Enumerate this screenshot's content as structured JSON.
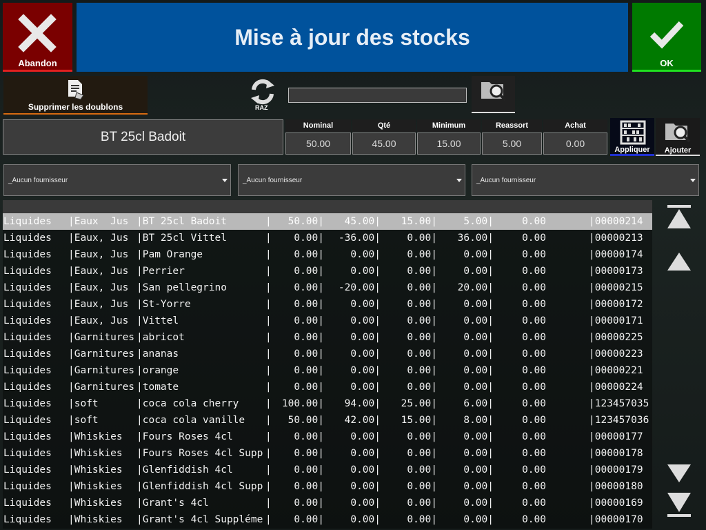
{
  "header": {
    "title": "Mise à jour des stocks",
    "abandon_label": "Abandon",
    "ok_label": "OK",
    "abandon_color": "#7a0000",
    "title_color": "#00529c",
    "ok_color": "#007a00"
  },
  "toolbar": {
    "dedup_label": "Supprimer les doublons",
    "raz_label": "RAZ",
    "search_value": ""
  },
  "product": {
    "name": "BT 25cl Badoit",
    "columns": [
      {
        "label": "Nominal",
        "value": "50.00"
      },
      {
        "label": "Qté",
        "value": "45.00"
      },
      {
        "label": "Minimum",
        "value": "15.00"
      },
      {
        "label": "Reassort",
        "value": "5.00"
      },
      {
        "label": "Achat",
        "value": "0.00"
      }
    ],
    "appliquer_label": "Appliquer",
    "ajouter_label": "Ajouter"
  },
  "suppliers": [
    "_Aucun fournisseur",
    "_Aucun fournisseur",
    "_Aucun fournisseur"
  ],
  "table": {
    "selected_index": 0,
    "rows": [
      [
        "Liquides",
        "|Eaux  Jus",
        "|BT 25cl Badoit",
        "|",
        "50.00|",
        "45.00|",
        "15.00|",
        "5.00|",
        "0.00",
        "|00000214"
      ],
      [
        "Liquides",
        "|Eaux, Jus",
        "|BT 25cl Vittel",
        "|",
        "0.00|",
        "-36.00|",
        "0.00|",
        "36.00|",
        "0.00",
        "|00000213"
      ],
      [
        "Liquides",
        "|Eaux, Jus",
        "|Pam Orange",
        "|",
        "0.00|",
        "0.00|",
        "0.00|",
        "0.00|",
        "0.00",
        "|00000174"
      ],
      [
        "Liquides",
        "|Eaux, Jus",
        "|Perrier",
        "|",
        "0.00|",
        "0.00|",
        "0.00|",
        "0.00|",
        "0.00",
        "|00000173"
      ],
      [
        "Liquides",
        "|Eaux, Jus",
        "|San pellegrino",
        "|",
        "0.00|",
        "-20.00|",
        "0.00|",
        "20.00|",
        "0.00",
        "|00000215"
      ],
      [
        "Liquides",
        "|Eaux, Jus",
        "|St-Yorre",
        "|",
        "0.00|",
        "0.00|",
        "0.00|",
        "0.00|",
        "0.00",
        "|00000172"
      ],
      [
        "Liquides",
        "|Eaux, Jus",
        "|Vittel",
        "|",
        "0.00|",
        "0.00|",
        "0.00|",
        "0.00|",
        "0.00",
        "|00000171"
      ],
      [
        "Liquides",
        "|Garnitures",
        "|abricot",
        "|",
        "0.00|",
        "0.00|",
        "0.00|",
        "0.00|",
        "0.00",
        "|00000225"
      ],
      [
        "Liquides",
        "|Garnitures",
        "|ananas",
        "|",
        "0.00|",
        "0.00|",
        "0.00|",
        "0.00|",
        "0.00",
        "|00000223"
      ],
      [
        "Liquides",
        "|Garnitures",
        "|orange",
        "|",
        "0.00|",
        "0.00|",
        "0.00|",
        "0.00|",
        "0.00",
        "|00000221"
      ],
      [
        "Liquides",
        "|Garnitures",
        "|tomate",
        "|",
        "0.00|",
        "0.00|",
        "0.00|",
        "0.00|",
        "0.00",
        "|00000224"
      ],
      [
        "Liquides",
        "|soft",
        "|coca cola cherry",
        "|",
        "100.00|",
        "94.00|",
        "25.00|",
        "6.00|",
        "0.00",
        "|123457035"
      ],
      [
        "Liquides",
        "|soft",
        "|coca cola vanille",
        "|",
        "50.00|",
        "42.00|",
        "15.00|",
        "8.00|",
        "0.00",
        "|123457036"
      ],
      [
        "Liquides",
        "|Whiskies",
        "|Fours Roses 4cl",
        "|",
        "0.00|",
        "0.00|",
        "0.00|",
        "0.00|",
        "0.00",
        "|00000177"
      ],
      [
        "Liquides",
        "|Whiskies",
        "|Fours Roses 4cl Supp",
        "|",
        "0.00|",
        "0.00|",
        "0.00|",
        "0.00|",
        "0.00",
        "|00000178"
      ],
      [
        "Liquides",
        "|Whiskies",
        "|Glenfiddish 4cl",
        "|",
        "0.00|",
        "0.00|",
        "0.00|",
        "0.00|",
        "0.00",
        "|00000179"
      ],
      [
        "Liquides",
        "|Whiskies",
        "|Glenfiddish 4cl Supp",
        "|",
        "0.00|",
        "0.00|",
        "0.00|",
        "0.00|",
        "0.00",
        "|00000180"
      ],
      [
        "Liquides",
        "|Whiskies",
        "|Grant's 4cl",
        "|",
        "0.00|",
        "0.00|",
        "0.00|",
        "0.00|",
        "0.00",
        "|00000169"
      ],
      [
        "Liquides",
        "|Whiskies",
        "|Grant's 4cl Suppléme",
        "|",
        "0.00|",
        "0.00|",
        "0.00|",
        "0.00|",
        "0.00",
        "|00000170"
      ]
    ]
  },
  "icons": {
    "abandon": "close-icon",
    "ok": "checkmark-icon",
    "dedup": "document-tag-icon",
    "raz": "refresh-icon",
    "search": "folder-search-icon",
    "appliquer": "abacus-icon",
    "ajouter": "folder-search-icon",
    "scroll": [
      "scroll-top-icon",
      "scroll-up-icon",
      "scroll-down-icon",
      "scroll-bottom-icon"
    ]
  }
}
